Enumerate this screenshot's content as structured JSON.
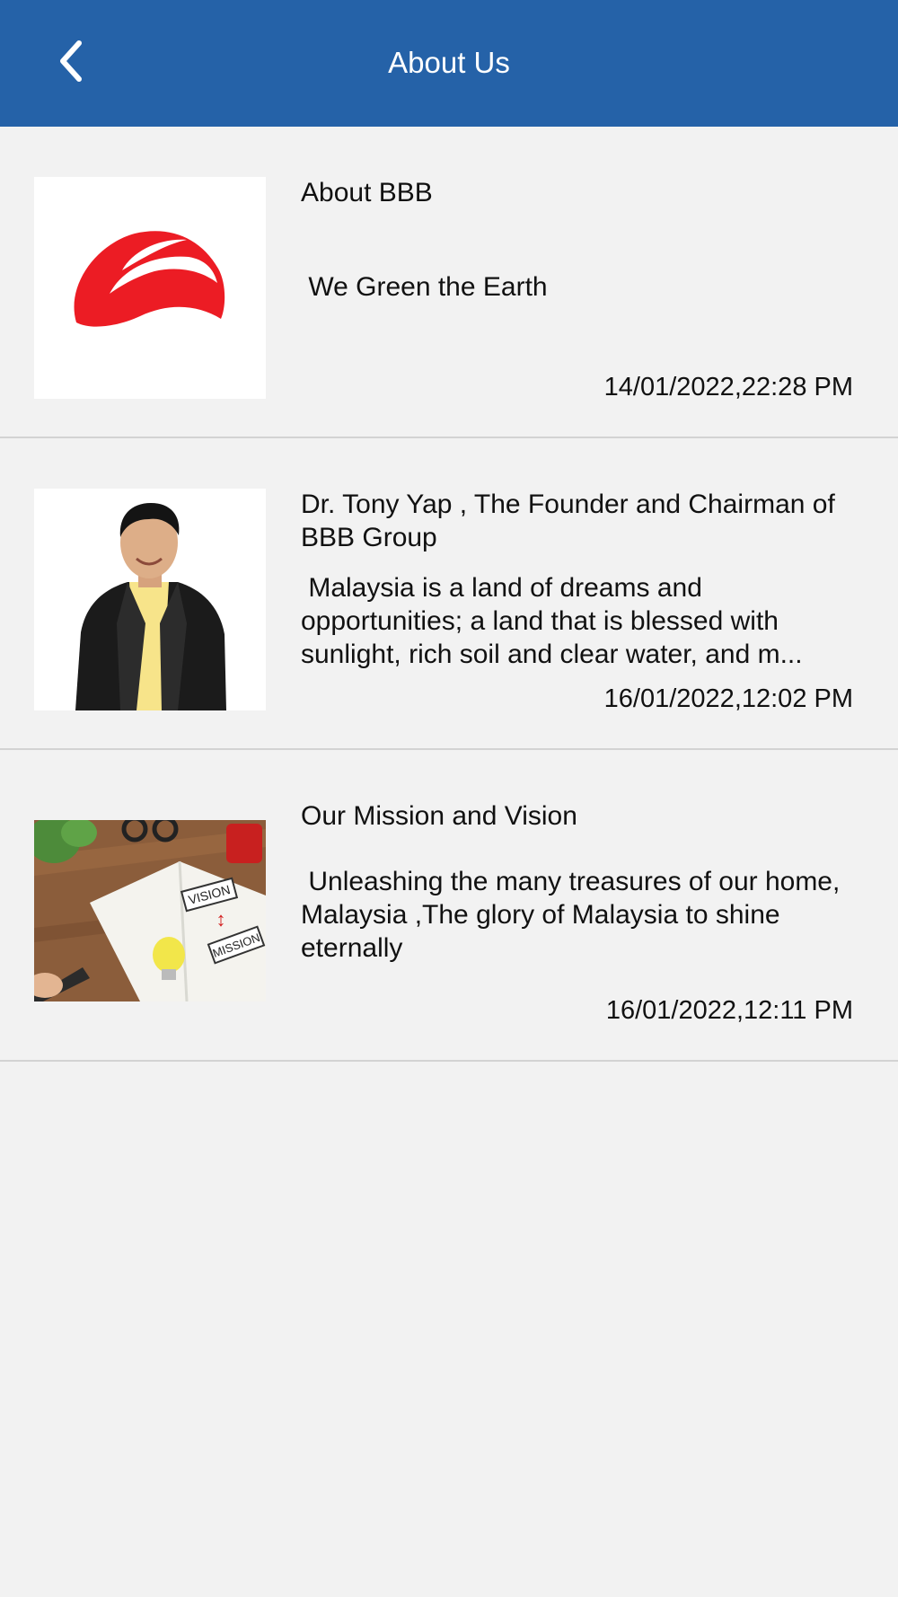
{
  "header": {
    "title": "About Us",
    "back_icon": "chevron-left-icon",
    "background_color": "#2562a8"
  },
  "items": [
    {
      "title": "About BBB",
      "description": " We Green the Earth",
      "date": "14/01/2022,22:28 PM",
      "image": "bbb-logo"
    },
    {
      "title": "Dr. Tony Yap , The Founder and Chairman of BBB Group",
      "description": " Malaysia is a land of dreams and opportunities; a land that is blessed with sunlight, rich soil and clear water, and m...",
      "date": "16/01/2022,12:02 PM",
      "image": "founder-portrait"
    },
    {
      "title": "Our Mission and Vision",
      "description": " Unleashing the many treasures of our home, Malaysia ,The glory of Malaysia to shine eternally",
      "date": "16/01/2022,12:11 PM",
      "image": "mission-vision-notebook"
    }
  ],
  "image_labels": {
    "vision": "VISION",
    "mission": "MISSION"
  }
}
